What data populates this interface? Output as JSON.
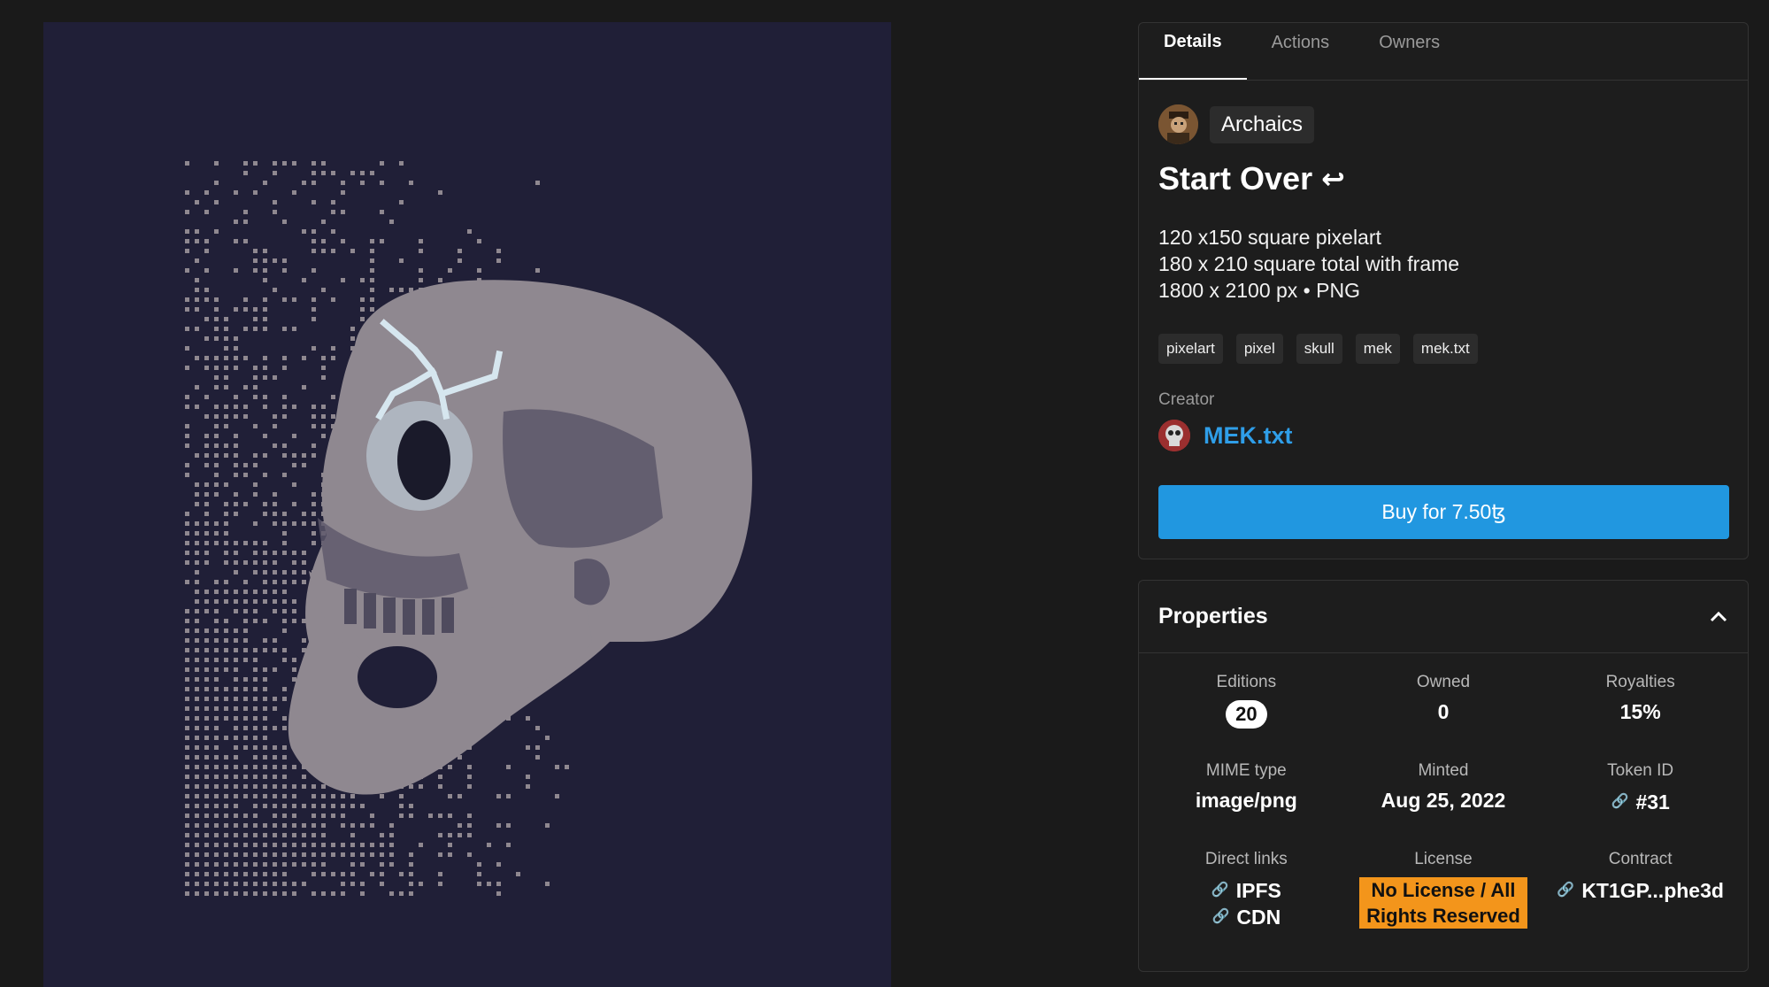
{
  "tabs": [
    {
      "label": "Details",
      "active": true
    },
    {
      "label": "Actions",
      "active": false
    },
    {
      "label": "Owners",
      "active": false
    }
  ],
  "collection": {
    "name": "Archaics",
    "avatar_icon": "portrait-icon"
  },
  "token": {
    "title": "Start Over",
    "title_icon": "return-arrow-icon",
    "description": [
      "120 x150 square pixelart",
      "180 x 210 square total with frame",
      "1800 x 2100 px • PNG"
    ],
    "tags": [
      "pixelart",
      "pixel",
      "skull",
      "mek",
      "mek.txt"
    ]
  },
  "creator": {
    "label": "Creator",
    "name": "MEK.txt",
    "avatar_icon": "skull-avatar-icon"
  },
  "buy_button": {
    "label": "Buy for 7.50ꜩ"
  },
  "properties": {
    "title": "Properties",
    "editions": {
      "label": "Editions",
      "value": "20"
    },
    "owned": {
      "label": "Owned",
      "value": "0"
    },
    "royalties": {
      "label": "Royalties",
      "value": "15%"
    },
    "mime": {
      "label": "MIME type",
      "value": "image/png"
    },
    "minted": {
      "label": "Minted",
      "value": "Aug 25, 2022"
    },
    "token_id": {
      "label": "Token ID",
      "value": "#31"
    },
    "direct_links": {
      "label": "Direct links",
      "links": [
        "IPFS",
        "CDN"
      ]
    },
    "license": {
      "label": "License",
      "value": "No License / All Rights Reserved"
    },
    "contract": {
      "label": "Contract",
      "value": "KT1GP...phe3d"
    }
  },
  "colors": {
    "art_background": "#201f37",
    "skull": "#8f8890",
    "crack": "#c9dbe6",
    "accent_blue": "#2197e0",
    "license_orange": "#f3951b"
  }
}
